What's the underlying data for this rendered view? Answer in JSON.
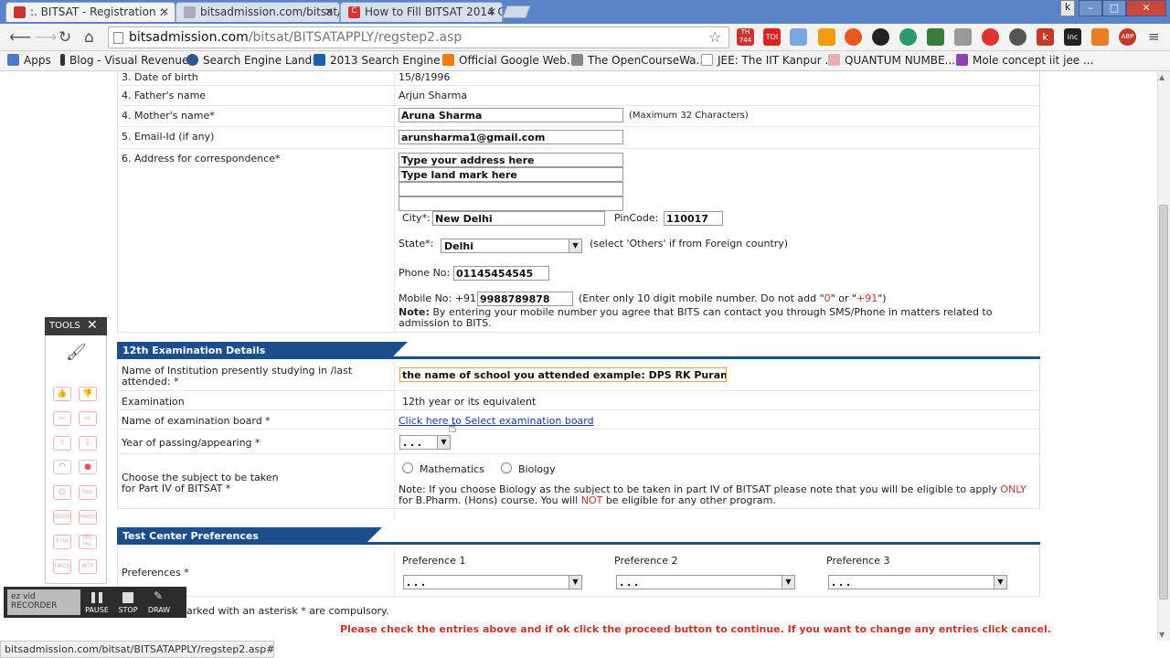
{
  "tabs": [
    {
      "title": ":. BITSAT - Registration :."
    },
    {
      "title": "bitsadmission.com/bitsat/"
    },
    {
      "title": "How to Fill BITSAT 2014 O"
    }
  ],
  "window_controls": {
    "user": "k",
    "min": "–",
    "max": "□",
    "close": "✕"
  },
  "omnibox": {
    "host": "bitsadmission.com",
    "path": "/bitsat/BITSATAPPLY/regstep2.asp"
  },
  "extensions": [
    "TH 744",
    "TOI",
    "ABP",
    "inc",
    "k"
  ],
  "bookmarks": [
    {
      "label": "Apps"
    },
    {
      "label": "Blog - Visual Revenue"
    },
    {
      "label": "Search Engine Land:..."
    },
    {
      "label": "2013 Search Engine ..."
    },
    {
      "label": "Official Google Web..."
    },
    {
      "label": "The OpenCourseWa..."
    },
    {
      "label": "JEE: The IIT Kanpur ..."
    },
    {
      "label": "QUANTUM NUMBE..."
    },
    {
      "label": "Mole concept iit jee ..."
    }
  ],
  "personal": {
    "dob_label": "3. Date of birth",
    "dob_value": "15/8/1996",
    "father_label": "4. Father's name",
    "father_value": "Arjun Sharma",
    "mother_label": "4. Mother's name*",
    "mother_value": "Aruna Sharma",
    "mother_hint": "(Maximum 32 Characters)",
    "email_label": "5. Email-Id (if any)",
    "email_value": "arunsharma1@gmail.com",
    "address_label": "6. Address for correspondence*",
    "address_line1": "Type your address here",
    "address_line2": "Type land mark here",
    "address_line3": "",
    "address_line4": "",
    "city_label": "City*:",
    "city_value": "New Delhi",
    "pincode_label": "PinCode:",
    "pincode_value": "110017",
    "state_label": "State*:",
    "state_value": "Delhi",
    "state_hint": "(select 'Others' if from Foreign country)",
    "phone_label": "Phone No:",
    "phone_value": "01145454545",
    "mobile_label": "Mobile No: +91",
    "mobile_value": "9988789878",
    "mobile_hint_a": "(Enter only 10 digit mobile number. Do not add \"",
    "mobile_hint_0": "0",
    "mobile_hint_b": "\" or \"",
    "mobile_hint_91": "+91",
    "mobile_hint_c": "\")",
    "mobile_note_bold": "Note:",
    "mobile_note": " By entering your mobile number you agree that BITS can contact you through SMS/Phone in matters related to admission to BITS."
  },
  "exam_section": {
    "header": "12th Examination Details",
    "institution_label": "Name of Institution presently studying in /last attended: *",
    "institution_value": "the name of school you attended example: DPS RK Puram",
    "exam_label": "Examination",
    "exam_value": "12th year or its equivalent",
    "board_label": "Name of examination board *",
    "board_link": "Click here to Select examination board",
    "year_label": "Year of passing/appearing *",
    "year_value": ". . .",
    "subject_label_1": "Choose the subject to be taken",
    "subject_label_2": "for Part IV of BITSAT *",
    "subject_opt1": "Mathematics",
    "subject_opt2": "Biology",
    "subject_note_a": "Note: If you choose Biology as the subject to be taken in part IV of BITSAT please note that you will be eligible to apply ",
    "subject_note_only": "ONLY",
    "subject_note_b": " for B.Pharm. (Hons) course. You will ",
    "subject_note_not": "NOT",
    "subject_note_c": " be eligible for any other program."
  },
  "test_center": {
    "header": "Test Center Preferences",
    "pref_label": "Preferences *",
    "pref1_label": "Preference 1",
    "pref2_label": "Preference 2",
    "pref3_label": "Preference 3",
    "pref_value": ". . ."
  },
  "footer": {
    "asterisk_note": "arked with an asterisk * are compulsory.",
    "proceed_note": "Please check the entries above and if ok click the proceed button to continue. If you want to change any entries click cancel."
  },
  "tools_panel": {
    "title": "TOOLS",
    "icons": [
      "FAIL",
      "NOOB",
      "PWNED",
      "FTW",
      "EPIC FAIL",
      "HACK",
      "WTF"
    ]
  },
  "recorder": {
    "logo": "ez vid RECORDER",
    "pause": "PAUSE",
    "stop": "STOP",
    "draw": "DRAW"
  },
  "status_bar": "bitsadmission.com/bitsat/BITSATAPPLY/regstep2.asp#",
  "colors": {
    "section_blue": "#1c4e8c",
    "alert_red": "#c0392b",
    "chrome_blue": "#5b84c8"
  }
}
